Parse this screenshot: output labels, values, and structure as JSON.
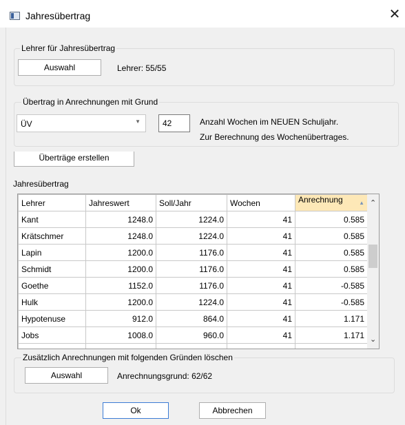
{
  "window": {
    "title": "Jahresübertrag",
    "close_glyph": "✕"
  },
  "teacher_group": {
    "label": "Lehrer für Jahresübertrag",
    "select_button": "Auswahl",
    "status": "Lehrer: 55/55"
  },
  "transfer_group": {
    "label": "Übertrag in Anrechnungen mit Grund",
    "reason_value": "ÜV",
    "weeks_value": "42",
    "weeks_description_line1": "Anzahl Wochen im NEUEN Schuljahr.",
    "weeks_description_line2": "Zur Berechnung des Wochenübertrages."
  },
  "create_button": "Überträge erstellen",
  "table_section": {
    "label": "Jahresübertrag",
    "columns": [
      "Lehrer",
      "Jahreswert",
      "Soll/Jahr",
      "Wochen",
      "Anrechnung"
    ],
    "rows": [
      [
        "Kant",
        "1248.0",
        "1224.0",
        "41",
        "0.585"
      ],
      [
        "Krätschmer",
        "1248.0",
        "1224.0",
        "41",
        "0.585"
      ],
      [
        "Lapin",
        "1200.0",
        "1176.0",
        "41",
        "0.585"
      ],
      [
        "Schmidt",
        "1200.0",
        "1176.0",
        "41",
        "0.585"
      ],
      [
        "Goethe",
        "1152.0",
        "1176.0",
        "41",
        "-0.585"
      ],
      [
        "Hulk",
        "1200.0",
        "1224.0",
        "41",
        "-0.585"
      ],
      [
        "Hypotenuse",
        "912.0",
        "864.0",
        "41",
        "1.171"
      ],
      [
        "Jobs",
        "1008.0",
        "960.0",
        "41",
        "1.171"
      ]
    ],
    "sorted_column": "Anrechnung"
  },
  "delete_group": {
    "label": "Zusätzlich Anrechnungen mit folgenden Gründen löschen",
    "select_button": "Auswahl",
    "status": "Anrechnungsgrund: 62/62"
  },
  "footer": {
    "ok": "Ok",
    "cancel": "Abbrechen"
  },
  "icons": [
    "app-icon",
    "close-icon",
    "sort-ascending-icon",
    "dropdown-arrow-icon",
    "scroll-up-icon",
    "scroll-down-icon"
  ]
}
